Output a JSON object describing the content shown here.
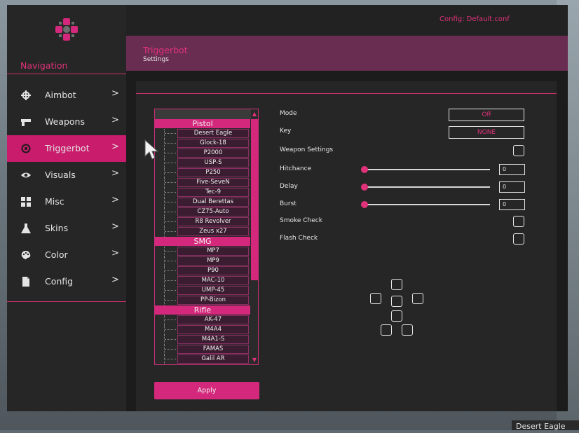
{
  "background": {
    "corner_label": "Desert Eagle"
  },
  "config": {
    "label": "Config: Default.conf"
  },
  "sidebar": {
    "title": "Navigation",
    "items": [
      {
        "label": "Aimbot",
        "icon": "crosshair-icon",
        "chevron": ">"
      },
      {
        "label": "Weapons",
        "icon": "pistol-icon",
        "chevron": ">"
      },
      {
        "label": "Triggerbot",
        "icon": "target-icon",
        "chevron": ">",
        "active": true
      },
      {
        "label": "Visuals",
        "icon": "eye-icon",
        "chevron": ">"
      },
      {
        "label": "Misc",
        "icon": "grid-icon",
        "chevron": ">"
      },
      {
        "label": "Skins",
        "icon": "flask-icon",
        "chevron": ">"
      },
      {
        "label": "Color",
        "icon": "palette-icon",
        "chevron": ">"
      },
      {
        "label": "Config",
        "icon": "file-icon",
        "chevron": ">"
      }
    ]
  },
  "header": {
    "title": "Triggerbot",
    "subtitle": "Settings"
  },
  "weapons": {
    "groups": [
      {
        "name": "Pistol",
        "items": [
          "Desert Eagle",
          "Glock-18",
          "P2000",
          "USP-S",
          "P250",
          "Five-SeveN",
          "Tec-9",
          "Dual Berettas",
          "CZ75-Auto",
          "R8 Revolver",
          "Zeus x27"
        ]
      },
      {
        "name": "SMG",
        "items": [
          "MP7",
          "MP9",
          "P90",
          "MAC-10",
          "UMP-45",
          "PP-Bizon"
        ]
      },
      {
        "name": "Rifle",
        "items": [
          "AK-47",
          "M4A4",
          "M4A1-S",
          "FAMAS",
          "Galil AR"
        ]
      }
    ],
    "apply_label": "Apply"
  },
  "settings": {
    "mode": {
      "label": "Mode",
      "value": "Off"
    },
    "key": {
      "label": "Key",
      "value": "NONE"
    },
    "weapon_settings": {
      "label": "Weapon Settings",
      "checked": false
    },
    "hitchance": {
      "label": "Hitchance",
      "value": "0",
      "level": 0
    },
    "delay": {
      "label": "Delay",
      "value": "0",
      "level": 0
    },
    "burst": {
      "label": "Burst",
      "value": "0",
      "level": 0
    },
    "smoke_check": {
      "label": "Smoke Check",
      "checked": false
    },
    "flash_check": {
      "label": "Flash Check",
      "checked": false
    }
  },
  "colors": {
    "accent": "#e0327a",
    "active": "#c91c6c",
    "header": "#6a2d52",
    "panel": "#262626"
  }
}
